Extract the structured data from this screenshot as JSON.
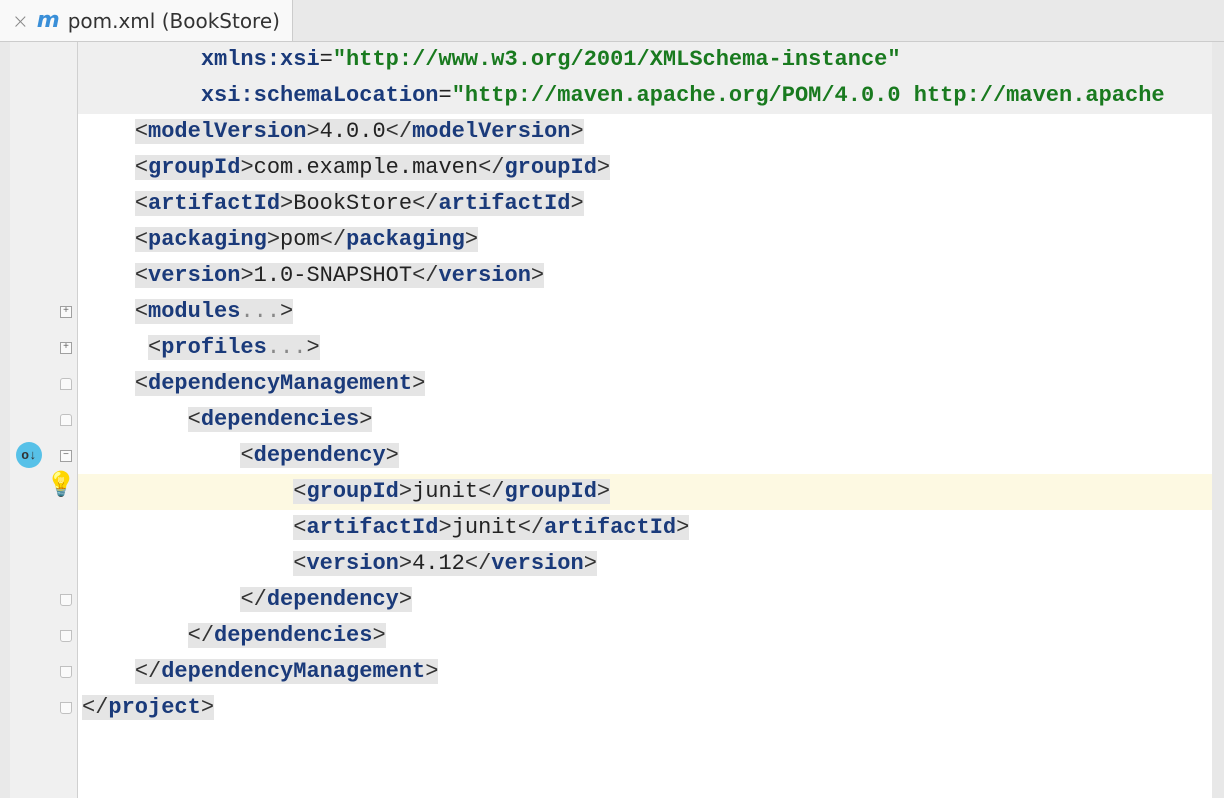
{
  "tab": {
    "title": "pom.xml (BookStore)",
    "close_glyph": "×"
  },
  "code": {
    "l1": {
      "indent": "         ",
      "ns": "xmlns:",
      "attr": "xsi",
      "eq": "=",
      "val": "\"http://www.w3.org/2001/XMLSchema-instance\""
    },
    "l2": {
      "indent": "         ",
      "ns": "xsi:",
      "attr": "schemaLocation",
      "eq": "=",
      "val": "\"http://maven.apache.org/POM/4.0.0 http://maven.apache"
    },
    "l3": {
      "indent": "    ",
      "tag": "modelVersion",
      "text": "4.0.0"
    },
    "l4": {
      "indent": "    ",
      "tag": "groupId",
      "text": "com.example.maven"
    },
    "l5": {
      "indent": "    ",
      "tag": "artifactId",
      "text": "BookStore"
    },
    "l6": {
      "indent": "    ",
      "tag": "packaging",
      "text": "pom"
    },
    "l7": {
      "indent": "    ",
      "tag": "version",
      "text": "1.0-SNAPSHOT"
    },
    "l8": {
      "indent": "    ",
      "tag": "modules",
      "dots": "..."
    },
    "l9": {
      "indent": "     ",
      "tag": "profiles",
      "dots": "..."
    },
    "l10": {
      "indent": "    ",
      "tag": "dependencyManagement"
    },
    "l11": {
      "indent": "        ",
      "tag": "dependencies"
    },
    "l12": {
      "indent": "            ",
      "tag": "dependency"
    },
    "l13": {
      "indent": "                ",
      "tag": "groupId",
      "text": "junit"
    },
    "l14": {
      "indent": "                ",
      "tag": "artifactId",
      "text": "junit"
    },
    "l15": {
      "indent": "                ",
      "tag": "version",
      "text": "4.12"
    },
    "l16": {
      "indent": "            ",
      "tag": "dependency"
    },
    "l17": {
      "indent": "        ",
      "tag": "dependencies"
    },
    "l18": {
      "indent": "    ",
      "tag": "dependencyManagement"
    },
    "l19": {
      "indent": "",
      "tag": "project"
    }
  },
  "icons": {
    "bulb": "💡",
    "plus": "+",
    "minus": "−",
    "circle_text": "o↓"
  }
}
